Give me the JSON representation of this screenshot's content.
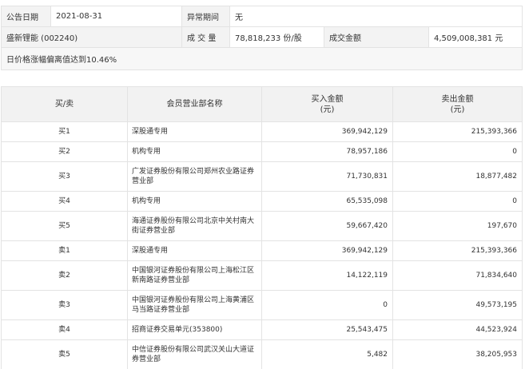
{
  "info": {
    "announce_date_label": "公告日期",
    "announce_date": "2021-08-31",
    "abnormal_period_label": "异常期间",
    "abnormal_period": "无",
    "stock": "盛新锂能 (002240)",
    "volume_label": "成 交 量",
    "volume": "78,818,233 份/股",
    "amount_label": "成交金额",
    "amount": "4,509,008,381 元",
    "reason": "日价格涨幅偏离值达到10.46%"
  },
  "table": {
    "headers": {
      "side": "买/卖",
      "member": "会员营业部名称",
      "buy_line1": "买入金额",
      "buy_line2": "(元)",
      "sell_line1": "卖出金额",
      "sell_line2": "(元)"
    },
    "rows": [
      {
        "side": "买1",
        "member": "深股通专用",
        "buy": "369,942,129",
        "sell": "215,393,366"
      },
      {
        "side": "买2",
        "member": "机构专用",
        "buy": "78,957,186",
        "sell": "0"
      },
      {
        "side": "买3",
        "member": "广发证券股份有限公司郑州农业路证券营业部",
        "buy": "71,730,831",
        "sell": "18,877,482"
      },
      {
        "side": "买4",
        "member": "机构专用",
        "buy": "65,535,098",
        "sell": "0"
      },
      {
        "side": "买5",
        "member": "海通证券股份有限公司北京中关村南大街证券营业部",
        "buy": "59,667,420",
        "sell": "197,670"
      },
      {
        "side": "卖1",
        "member": "深股通专用",
        "buy": "369,942,129",
        "sell": "215,393,366"
      },
      {
        "side": "卖2",
        "member": "中国银河证券股份有限公司上海松江区新南路证券营业部",
        "buy": "14,122,119",
        "sell": "71,834,640"
      },
      {
        "side": "卖3",
        "member": "中国银河证券股份有限公司上海黄浦区马当路证券营业部",
        "buy": "0",
        "sell": "49,573,195"
      },
      {
        "side": "卖4",
        "member": "招商证券交易单元(353800)",
        "buy": "25,543,475",
        "sell": "44,523,924"
      },
      {
        "side": "卖5",
        "member": "中信证券股份有限公司武汉关山大道证券营业部",
        "buy": "5,482",
        "sell": "38,205,953"
      }
    ]
  }
}
